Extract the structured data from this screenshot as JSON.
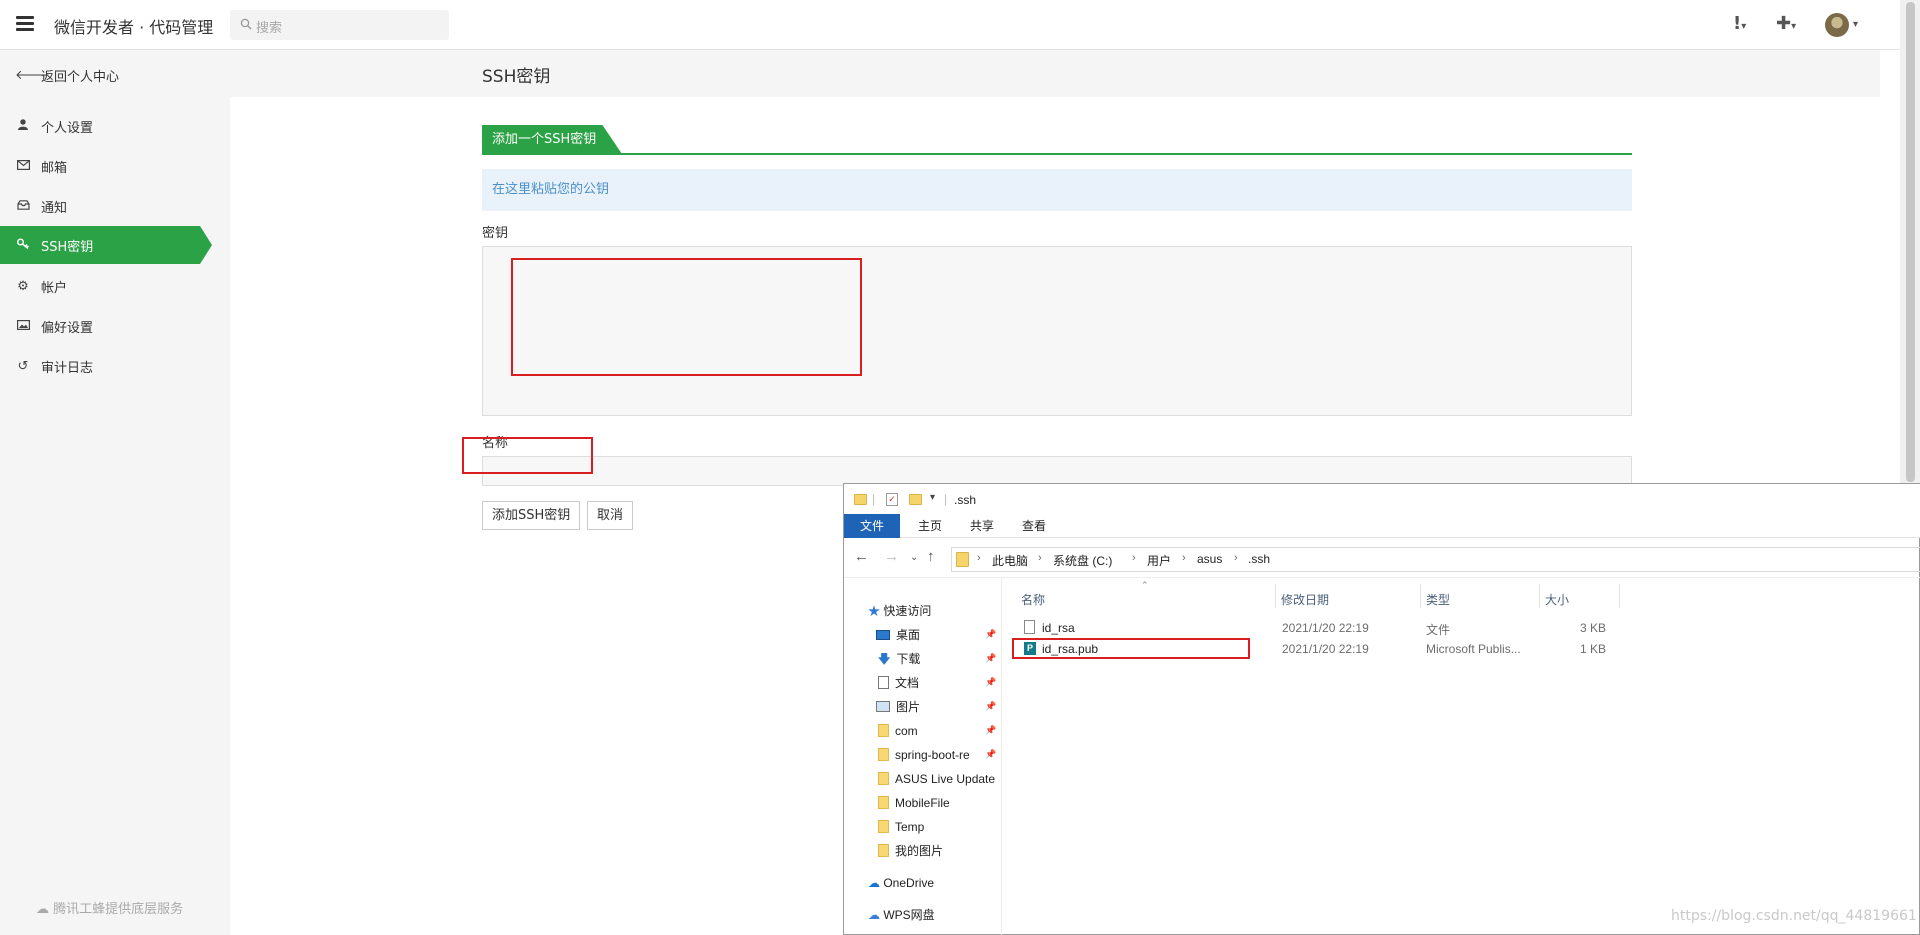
{
  "app": {
    "title": "微信开发者 · 代码管理",
    "search_placeholder": "搜索"
  },
  "sidebar": {
    "back": "返回个人中心",
    "items": [
      {
        "label": "个人设置",
        "icon": "user-icon"
      },
      {
        "label": "邮箱",
        "icon": "envelope-icon"
      },
      {
        "label": "通知",
        "icon": "inbox-icon"
      },
      {
        "label": "SSH密钥",
        "icon": "key-icon",
        "active": true
      },
      {
        "label": "帐户",
        "icon": "gear-icon"
      },
      {
        "label": "偏好设置",
        "icon": "image-icon"
      },
      {
        "label": "审计日志",
        "icon": "history-icon"
      }
    ],
    "footer": "腾讯工蜂提供底层服务"
  },
  "main": {
    "page_title": "SSH密钥",
    "tab": "添加一个SSH密钥",
    "hint": "在这里粘贴您的公钥",
    "key_label": "密钥",
    "name_label": "名称",
    "submit": "添加SSH密钥",
    "cancel": "取消"
  },
  "explorer": {
    "title": ".ssh",
    "ribbon": [
      "文件",
      "主页",
      "共享",
      "查看"
    ],
    "path": [
      "此电脑",
      "系统盘 (C:)",
      "用户",
      "asus",
      ".ssh"
    ],
    "nav": {
      "quick_access": "快速访问",
      "items": [
        "桌面",
        "下载",
        "文档",
        "图片",
        "com",
        "spring-boot-re",
        "ASUS Live Update",
        "MobileFile",
        "Temp",
        "我的图片"
      ],
      "onedrive": "OneDrive",
      "wps": "WPS网盘"
    },
    "columns": [
      "名称",
      "修改日期",
      "类型",
      "大小"
    ],
    "files": [
      {
        "name": "id_rsa",
        "date": "2021/1/20 22:19",
        "type": "文件",
        "size": "3 KB"
      },
      {
        "name": "id_rsa.pub",
        "date": "2021/1/20 22:19",
        "type": "Microsoft Publis...",
        "size": "1 KB"
      }
    ]
  },
  "watermark": "https://blog.csdn.net/qq_44819661",
  "colors": {
    "accent": "#2ba245",
    "hint_bg": "#e9f2fa",
    "highlight": "#d81e1e"
  }
}
